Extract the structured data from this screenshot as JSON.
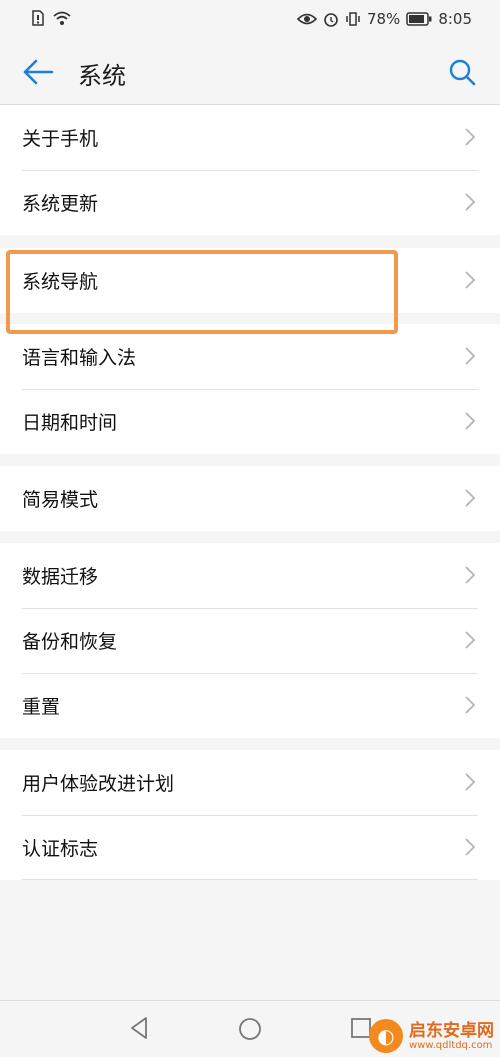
{
  "status_bar": {
    "battery": "78%",
    "time": "8:05"
  },
  "header": {
    "title": "系统"
  },
  "groups": [
    {
      "items": [
        "关于手机",
        "系统更新"
      ]
    },
    {
      "items": [
        "系统导航"
      ]
    },
    {
      "items": [
        "语言和输入法",
        "日期和时间"
      ]
    },
    {
      "items": [
        "简易模式"
      ]
    },
    {
      "items": [
        "数据迁移",
        "备份和恢复",
        "重置"
      ]
    },
    {
      "items": [
        "用户体验改进计划",
        "认证标志"
      ]
    }
  ],
  "highlight": {
    "target": "系统导航",
    "color": "#ef9a4f"
  },
  "watermark": {
    "text": "启东安卓网",
    "url": "www.qdltdq.com"
  },
  "icons": [
    "back-arrow-icon",
    "search-icon",
    "chevron-right-icon",
    "nav-back-icon",
    "nav-home-icon",
    "nav-recent-icon"
  ]
}
